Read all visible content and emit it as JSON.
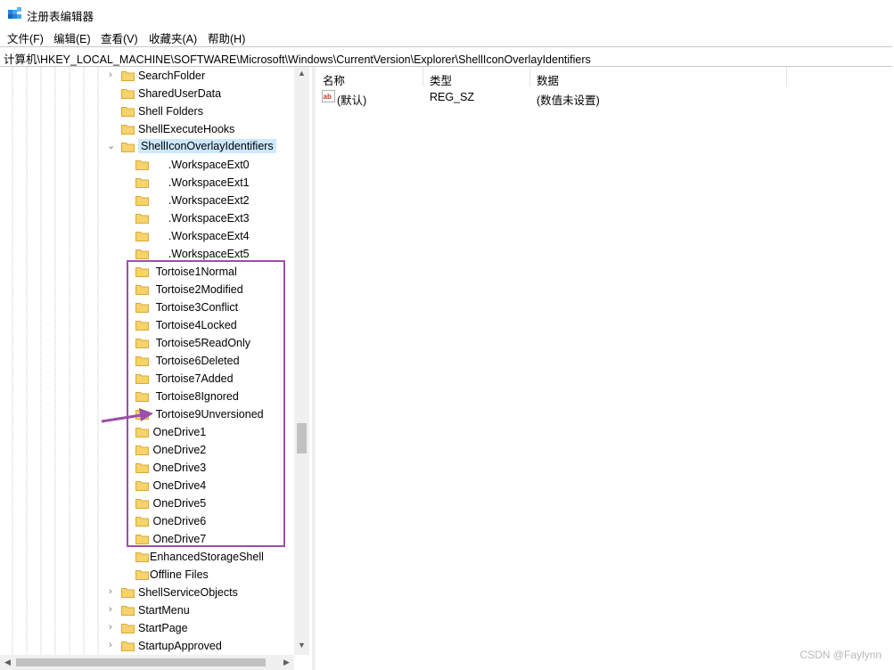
{
  "window": {
    "title": "注册表编辑器"
  },
  "menu": [
    "文件(F)",
    "编辑(E)",
    "查看(V)",
    "收藏夹(A)",
    "帮助(H)"
  ],
  "address": "计算机\\HKEY_LOCAL_MACHINE\\SOFTWARE\\Microsoft\\Windows\\CurrentVersion\\Explorer\\ShellIconOverlayIdentifiers",
  "tree": [
    {
      "label": "SearchFolder",
      "expander": "›"
    },
    {
      "label": "SharedUserData",
      "expander": ""
    },
    {
      "label": "Shell Folders",
      "expander": ""
    },
    {
      "label": "ShellExecuteHooks",
      "expander": ""
    },
    {
      "label": "ShellIconOverlayIdentifiers",
      "expander": "⌄"
    },
    {
      "label": "      .WorkspaceExt0",
      "expander": ""
    },
    {
      "label": "      .WorkspaceExt1",
      "expander": ""
    },
    {
      "label": "      .WorkspaceExt2",
      "expander": ""
    },
    {
      "label": "      .WorkspaceExt3",
      "expander": ""
    },
    {
      "label": "      .WorkspaceExt4",
      "expander": ""
    },
    {
      "label": "      .WorkspaceExt5",
      "expander": ""
    },
    {
      "label": "  Tortoise1Normal",
      "expander": ""
    },
    {
      "label": "  Tortoise2Modified",
      "expander": ""
    },
    {
      "label": "  Tortoise3Conflict",
      "expander": ""
    },
    {
      "label": "  Tortoise4Locked",
      "expander": ""
    },
    {
      "label": "  Tortoise5ReadOnly",
      "expander": ""
    },
    {
      "label": "  Tortoise6Deleted",
      "expander": ""
    },
    {
      "label": "  Tortoise7Added",
      "expander": ""
    },
    {
      "label": "  Tortoise8Ignored",
      "expander": ""
    },
    {
      "label": "  Tortoise9Unversioned",
      "expander": ""
    },
    {
      "label": " OneDrive1",
      "expander": ""
    },
    {
      "label": " OneDrive2",
      "expander": ""
    },
    {
      "label": " OneDrive3",
      "expander": ""
    },
    {
      "label": " OneDrive4",
      "expander": ""
    },
    {
      "label": " OneDrive5",
      "expander": ""
    },
    {
      "label": " OneDrive6",
      "expander": ""
    },
    {
      "label": " OneDrive7",
      "expander": ""
    },
    {
      "label": "EnhancedStorageShell",
      "expander": ""
    },
    {
      "label": "Offline Files",
      "expander": ""
    },
    {
      "label": "ShellServiceObjects",
      "expander": "›"
    },
    {
      "label": "StartMenu",
      "expander": "›"
    },
    {
      "label": "StartPage",
      "expander": "›"
    },
    {
      "label": "StartupApproved",
      "expander": "›"
    }
  ],
  "list": {
    "columns": [
      "名称",
      "类型",
      "数据"
    ],
    "rows": [
      {
        "name": "(默认)",
        "type": "REG_SZ",
        "data": "(数值未设置)"
      }
    ]
  },
  "watermark": "CSDN @Faylynn",
  "colors": {
    "highlight": "#9b4fa6",
    "folder": "#f6d36b",
    "selection": "#cce8ff"
  }
}
